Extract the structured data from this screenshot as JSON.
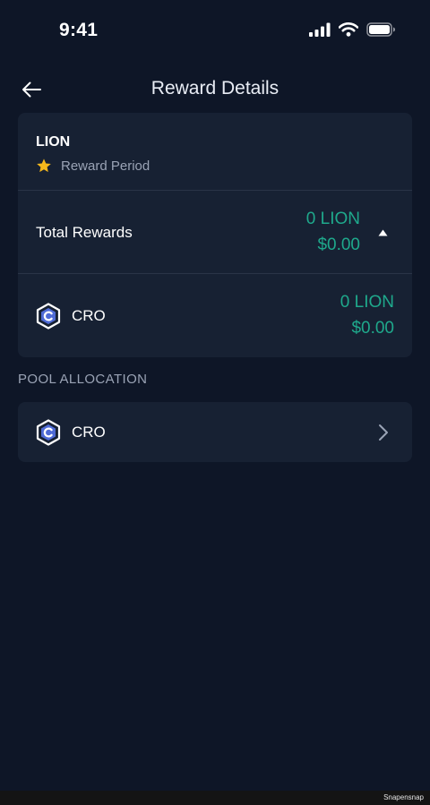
{
  "status_bar": {
    "time": "9:41"
  },
  "nav": {
    "title": "Reward Details",
    "back_icon": "arrow-left-icon"
  },
  "reward_card": {
    "token_name": "LION",
    "period_label": "Reward Period",
    "period_icon": "star-icon",
    "total_rewards_label": "Total Rewards",
    "total_amount": "0 LION",
    "total_fiat": "$0.00",
    "breakdown": [
      {
        "coin": "CRO",
        "amount": "0 LION",
        "fiat": "$0.00"
      }
    ]
  },
  "pool_allocation": {
    "header": "POOL ALLOCATION",
    "items": [
      {
        "coin": "CRO"
      }
    ]
  },
  "footer": {
    "watermark": "Snapensnap"
  },
  "colors": {
    "background": "#0e1627",
    "card": "#172133",
    "accent_green": "#1fa98c",
    "star": "#f5b81c",
    "muted_text": "#9aa3b5"
  }
}
